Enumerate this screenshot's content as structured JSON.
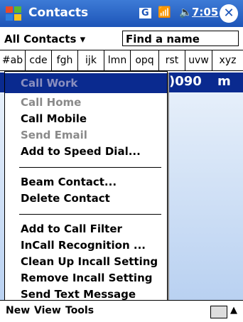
{
  "titlebar": {
    "title": "Contacts",
    "app_badge": "G",
    "time": "7:05",
    "close_label": "✕"
  },
  "category": {
    "label": "All Contacts ▾",
    "find_placeholder": "Find a name"
  },
  "alpha_tabs": [
    "#ab",
    "cde",
    "fgh",
    "ijk",
    "lmn",
    "opq",
    "rst",
    "uvw",
    "xyz"
  ],
  "selected_row": {
    "number": ")090",
    "tag": "m"
  },
  "menu": {
    "items": [
      {
        "label": "Call Work",
        "state": "active"
      },
      {
        "label": "Call Home",
        "state": "disabled"
      },
      {
        "label": "Call Mobile",
        "state": "enabled"
      },
      {
        "label": "Send Email",
        "state": "disabled"
      },
      {
        "label": "Add to Speed Dial...",
        "state": "enabled"
      },
      {
        "label": "Beam Contact...",
        "state": "enabled"
      },
      {
        "label": "Delete Contact",
        "state": "enabled"
      },
      {
        "label": "Add to Call Filter",
        "state": "enabled"
      },
      {
        "label": "InCall Recognition ...",
        "state": "enabled"
      },
      {
        "label": "Clean Up Incall Setting",
        "state": "enabled"
      },
      {
        "label": "Remove Incall Setting",
        "state": "enabled"
      },
      {
        "label": "Send Text Message",
        "state": "enabled"
      }
    ]
  },
  "menubar": {
    "items": [
      "New",
      "View",
      "Tools"
    ]
  }
}
